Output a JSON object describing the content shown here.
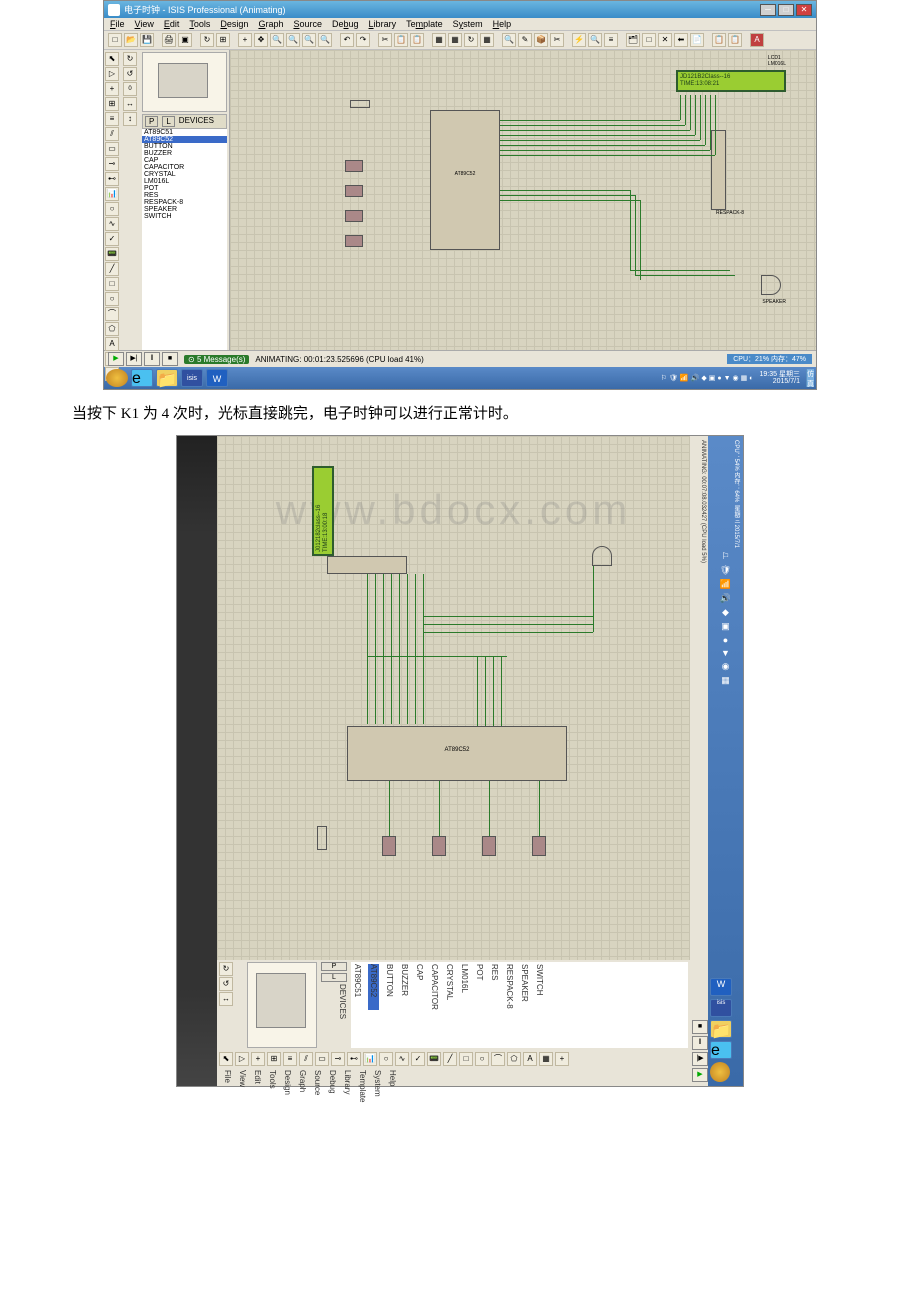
{
  "window": {
    "title": "电子时钟 - ISIS Professional (Animating)",
    "icon": "isis-icon"
  },
  "menus": [
    "File",
    "View",
    "Edit",
    "Tools",
    "Design",
    "Graph",
    "Source",
    "Debug",
    "Library",
    "Template",
    "System",
    "Help"
  ],
  "devices": {
    "header": "DEVICES",
    "buttons": [
      "P",
      "L"
    ],
    "selected": "AT89C52",
    "items": [
      "AT89C51",
      "AT89C52",
      "BUTTON",
      "BUZZER",
      "CAP",
      "CAPACITOR",
      "CRYSTAL",
      "LM016L",
      "POT",
      "RES",
      "RESPACK-8",
      "SPEAKER",
      "SWITCH"
    ]
  },
  "lcd": {
    "line1": "JD121B2Class--16",
    "line2": "TIME:13:08:21"
  },
  "lcd2": {
    "line1": "J012182class--16",
    "line2": "TIME:13:00:18"
  },
  "status": {
    "messages": "5 Message(s)",
    "animating": "ANIMATING: 00:01:23.525696 (CPU load 41%)",
    "animating2": "ANIMATING: 00:07:08.032427 (CPU load 5%)",
    "cpu": "CPU：21% 内存：47%",
    "cpu2": "CPU：54% 内存：64%"
  },
  "tray": {
    "time": "19:35",
    "date": "2015/7/1",
    "day": "星期三",
    "time2": "19:59",
    "extra": "仿真中"
  },
  "caption": "当按下 K1 为 4 次时，光标直接跳完，电子时钟可以进行正常计时。",
  "watermark": "www.bdocx.com",
  "components": {
    "u1": "AT89C52",
    "lcd_name": "LCD1",
    "lcd_model": "LM016L",
    "rp1": "RESPACK-8",
    "speaker": "SPEAKER",
    "crystal": "CRYSTAL"
  }
}
